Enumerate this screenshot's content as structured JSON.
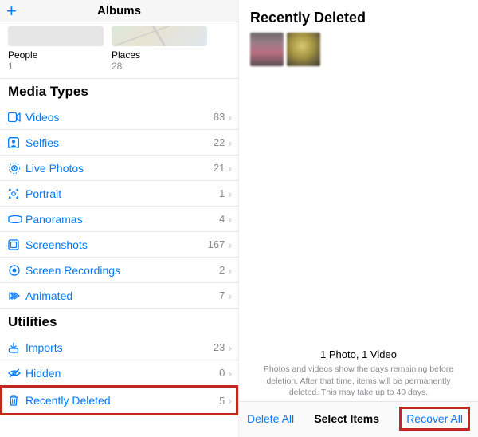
{
  "left": {
    "header_title": "Albums",
    "albums": [
      {
        "label": "People",
        "count": "1"
      },
      {
        "label": "Places",
        "count": "28"
      }
    ],
    "sections": [
      {
        "title": "Media Types",
        "rows": [
          {
            "icon": "video-icon",
            "label": "Videos",
            "count": "83"
          },
          {
            "icon": "selfie-icon",
            "label": "Selfies",
            "count": "22"
          },
          {
            "icon": "livephoto-icon",
            "label": "Live Photos",
            "count": "21"
          },
          {
            "icon": "portrait-icon",
            "label": "Portrait",
            "count": "1"
          },
          {
            "icon": "panorama-icon",
            "label": "Panoramas",
            "count": "4"
          },
          {
            "icon": "screenshot-icon",
            "label": "Screenshots",
            "count": "167"
          },
          {
            "icon": "screenrec-icon",
            "label": "Screen Recordings",
            "count": "2"
          },
          {
            "icon": "animated-icon",
            "label": "Animated",
            "count": "7"
          }
        ]
      },
      {
        "title": "Utilities",
        "rows": [
          {
            "icon": "import-icon",
            "label": "Imports",
            "count": "23"
          },
          {
            "icon": "hidden-icon",
            "label": "Hidden",
            "count": "0"
          },
          {
            "icon": "trash-icon",
            "label": "Recently Deleted",
            "count": "5",
            "highlight": true
          }
        ]
      }
    ]
  },
  "right": {
    "title": "Recently Deleted",
    "summary_line1": "1 Photo, 1 Video",
    "summary_line2": "Photos and videos show the days remaining before deletion. After that time, items will be permanently deleted. This may take up to 40 days.",
    "toolbar": {
      "delete_all": "Delete All",
      "select_items": "Select Items",
      "recover_all": "Recover All"
    }
  }
}
